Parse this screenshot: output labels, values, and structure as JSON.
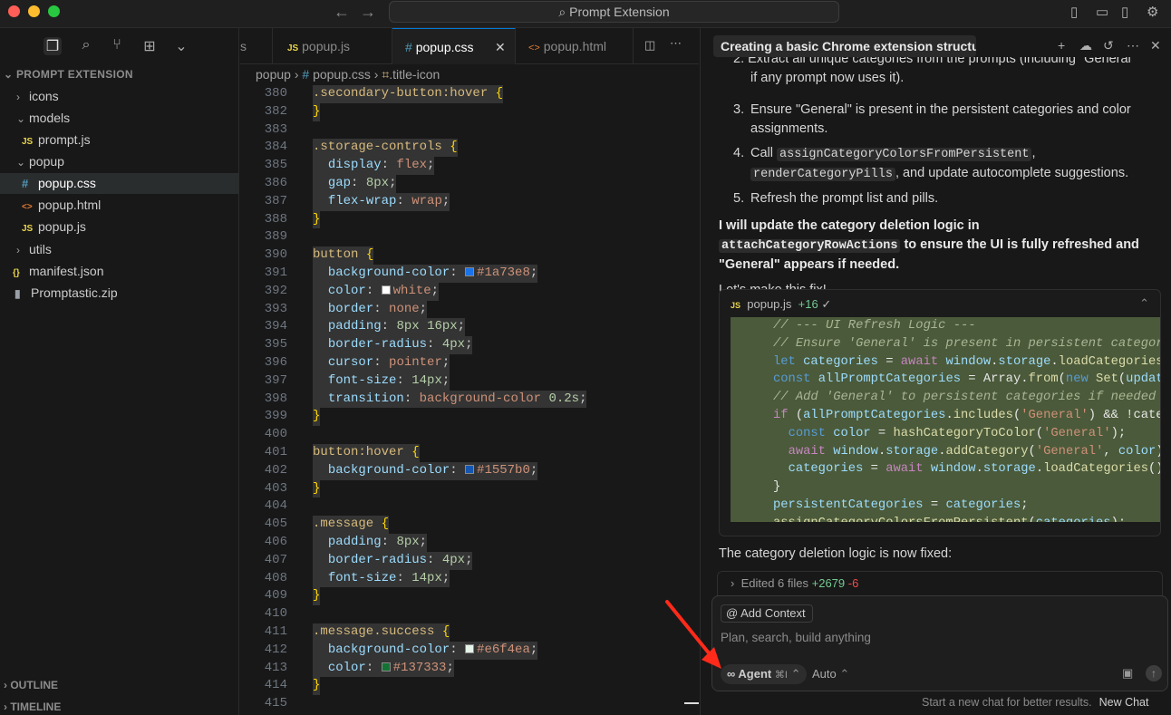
{
  "window": {
    "search_label": "Prompt Extension",
    "traffic_colors": [
      "#ff5f57",
      "#febc2e",
      "#28c840"
    ]
  },
  "explorer": {
    "title": "PROMPT EXTENSION",
    "items": [
      {
        "label": "icons",
        "type": "folder",
        "expanded": false
      },
      {
        "label": "models",
        "type": "folder",
        "expanded": true
      },
      {
        "label": "prompt.js",
        "type": "js"
      },
      {
        "label": "popup",
        "type": "folder",
        "expanded": true
      },
      {
        "label": "popup.css",
        "type": "css",
        "selected": true
      },
      {
        "label": "popup.html",
        "type": "html"
      },
      {
        "label": "popup.js",
        "type": "js"
      },
      {
        "label": "utils",
        "type": "folder",
        "expanded": false
      },
      {
        "label": "manifest.json",
        "type": "json"
      },
      {
        "label": "Promptastic.zip",
        "type": "zip"
      }
    ],
    "outline": "OUTLINE",
    "timeline": "TIMELINE"
  },
  "tabs": [
    {
      "label": "s",
      "icon": "",
      "active": false
    },
    {
      "label": "popup.js",
      "icon": "JS",
      "active": false
    },
    {
      "label": "popup.css",
      "icon": "#",
      "active": true
    },
    {
      "label": "popup.html",
      "icon": "<>",
      "active": false
    }
  ],
  "breadcrumb": {
    "folder": "popup",
    "file": "popup.css",
    "symbol": ".title-icon"
  },
  "code_lines": [
    {
      "n": "380",
      "t": ".secondary-button:hover {"
    },
    {
      "n": "382",
      "t": "}"
    },
    {
      "n": "383",
      "t": ""
    },
    {
      "n": "384",
      "t": ".storage-controls {"
    },
    {
      "n": "385",
      "t": "  display: flex;"
    },
    {
      "n": "386",
      "t": "  gap: 8px;"
    },
    {
      "n": "387",
      "t": "  flex-wrap: wrap;"
    },
    {
      "n": "388",
      "t": "}"
    },
    {
      "n": "389",
      "t": ""
    },
    {
      "n": "390",
      "t": "button {"
    },
    {
      "n": "391",
      "t": "  background-color: #1a73e8;"
    },
    {
      "n": "392",
      "t": "  color: white;"
    },
    {
      "n": "393",
      "t": "  border: none;"
    },
    {
      "n": "394",
      "t": "  padding: 8px 16px;"
    },
    {
      "n": "395",
      "t": "  border-radius: 4px;"
    },
    {
      "n": "396",
      "t": "  cursor: pointer;"
    },
    {
      "n": "397",
      "t": "  font-size: 14px;"
    },
    {
      "n": "398",
      "t": "  transition: background-color 0.2s;"
    },
    {
      "n": "399",
      "t": "}"
    },
    {
      "n": "400",
      "t": ""
    },
    {
      "n": "401",
      "t": "button:hover {"
    },
    {
      "n": "402",
      "t": "  background-color: #1557b0;"
    },
    {
      "n": "403",
      "t": "}"
    },
    {
      "n": "404",
      "t": ""
    },
    {
      "n": "405",
      "t": ".message {"
    },
    {
      "n": "406",
      "t": "  padding: 8px;"
    },
    {
      "n": "407",
      "t": "  border-radius: 4px;"
    },
    {
      "n": "408",
      "t": "  font-size: 14px;"
    },
    {
      "n": "409",
      "t": "}"
    },
    {
      "n": "410",
      "t": ""
    },
    {
      "n": "411",
      "t": ".message.success {"
    },
    {
      "n": "412",
      "t": "  background-color: #e6f4ea;"
    },
    {
      "n": "413",
      "t": "  color: #137333;"
    },
    {
      "n": "414",
      "t": "}"
    },
    {
      "n": "415",
      "t": ""
    }
  ],
  "chat": {
    "title": "Creating a basic Chrome extension structur",
    "cut_line": "2. Extract all unique categories from the prompts (including \"General\"",
    "cut_line_cont": "if any prompt now uses it).",
    "step3": "Ensure \"General\" is present in the persistent categories and color assignments.",
    "step4_pre": "Call ",
    "step4_code1": "assignCategoryColorsFromPersistent",
    "step4_code2": "renderCategoryPills",
    "step4_post": ", and update autocomplete suggestions.",
    "step5": "Refresh the prompt list and pills.",
    "bold_pre": "I will update the category deletion logic in ",
    "bold_code": "attachCategoryRowActions",
    "bold_post": " to ensure the UI is fully refreshed and \"General\" appears if needed.",
    "lets": "Let's make this fix!",
    "card_file": "popup.js",
    "card_diff": "+16",
    "diff_lines": [
      "// --- UI Refresh Logic ---",
      "// Ensure 'General' is present in persistent categorie",
      "let categories = await window.storage.loadCategories()",
      "const allPromptCategories = Array.from(new Set(updated",
      "// Add 'General' to persistent categories if needed",
      "if (allPromptCategories.includes('General') && !catego",
      "  const color = hashCategoryToColor('General');",
      "  await window.storage.addCategory('General', color);",
      "  categories = await window.storage.loadCategories();",
      "}",
      "persistentCategories = categories;",
      "assignCategoryColorsFromPersistent(categories);"
    ],
    "fixed_text": "The category deletion logic is now fixed:",
    "edited_label": "Edited 6 files",
    "edited_plus": "+2679",
    "edited_minus": "-6",
    "add_context": "Add Context",
    "placeholder": "Plan, search, build anything",
    "agent_label": "Agent",
    "agent_shortcut": "⌘I",
    "auto_label": "Auto",
    "footer_hint": "Start a new chat for better results.",
    "new_chat": "New Chat"
  }
}
